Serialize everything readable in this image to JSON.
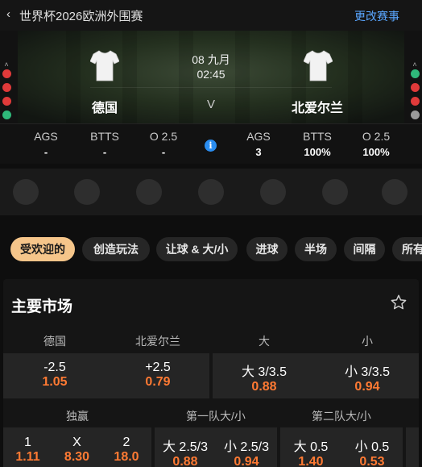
{
  "header": {
    "back_icon": "chevron-left-icon",
    "competition": "世界杯2026欧洲外围赛",
    "change_link": "更改赛事"
  },
  "match": {
    "home": {
      "name": "德国"
    },
    "away": {
      "name": "北爱尔兰"
    },
    "date": "08 九月",
    "time": "02:45",
    "vs": "V",
    "home_form": [
      "#e03a3a",
      "#e03a3a",
      "#e03a3a",
      "#2fb87a",
      "#9a9a9a"
    ],
    "away_form": [
      "#2fb87a",
      "#e03a3a",
      "#e03a3a",
      "#9a9a9a",
      "#9a9a9a"
    ],
    "kit_color": "#f2f2f2"
  },
  "stats": {
    "home": [
      {
        "label": "AGS",
        "value": "-"
      },
      {
        "label": "BTTS",
        "value": "-"
      },
      {
        "label": "O 2.5",
        "value": "-"
      }
    ],
    "away": [
      {
        "label": "AGS",
        "value": "3"
      },
      {
        "label": "BTTS",
        "value": "100%"
      },
      {
        "label": "O 2.5",
        "value": "100%"
      }
    ],
    "info_icon": "i"
  },
  "tabs": [
    "受欢迎的",
    "创造玩法",
    "让球 & 大/小",
    "进球",
    "半场",
    "间隔",
    "所有"
  ],
  "market": {
    "title": "主要市场",
    "star_icon": "star-outline-icon",
    "handicap_headers": [
      "德国",
      "北爱尔兰"
    ],
    "handicap": [
      {
        "line": "-2.5",
        "odds": "1.05"
      },
      {
        "line": "+2.5",
        "odds": "0.79"
      }
    ],
    "totals_headers": [
      "大",
      "小"
    ],
    "totals": [
      {
        "line": "大 3/3.5",
        "odds": "0.88"
      },
      {
        "line": "小 3/3.5",
        "odds": "0.94"
      }
    ],
    "win_header": "独赢",
    "win": [
      {
        "line": "1",
        "odds": "1.11"
      },
      {
        "line": "X",
        "odds": "8.30"
      },
      {
        "line": "2",
        "odds": "18.0"
      }
    ],
    "team1_header": "第一队大/小",
    "team1": [
      {
        "line": "大 2.5/3",
        "odds": "0.88"
      },
      {
        "line": "小 2.5/3",
        "odds": "0.94"
      }
    ],
    "team2_header": "第二队大/小",
    "team2": [
      {
        "line": "大 0.5",
        "odds": "1.40"
      },
      {
        "line": "小 0.5",
        "odds": "0.53"
      }
    ]
  }
}
